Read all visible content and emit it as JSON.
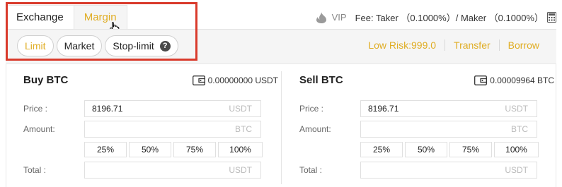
{
  "tabs": {
    "exchange": "Exchange",
    "margin": "Margin"
  },
  "fee": {
    "vip": "VIP",
    "text": "Fee: Taker （0.1000%）/ Maker （0.1000%）"
  },
  "order_types": {
    "limit": "Limit",
    "market": "Market",
    "stop_limit": "Stop-limit",
    "help": "?"
  },
  "links": {
    "risk": "Low Risk:999.0",
    "transfer": "Transfer",
    "borrow": "Borrow"
  },
  "buy": {
    "title": "Buy BTC",
    "balance": "0.00000000 USDT",
    "price_label": "Price :",
    "price_value": "8196.71",
    "price_unit": "USDT",
    "amount_label": "Amount:",
    "amount_unit": "BTC",
    "total_label": "Total :",
    "total_unit": "USDT"
  },
  "sell": {
    "title": "Sell BTC",
    "balance": "0.00009964 BTC",
    "price_label": "Price :",
    "price_value": "8196.71",
    "price_unit": "USDT",
    "amount_label": "Amount:",
    "amount_unit": "BTC",
    "total_label": "Total :",
    "total_unit": "USDT"
  },
  "percents": [
    "25%",
    "50%",
    "75%",
    "100%"
  ],
  "colors": {
    "accent": "#e0ad23",
    "highlight": "#d93a2b"
  }
}
